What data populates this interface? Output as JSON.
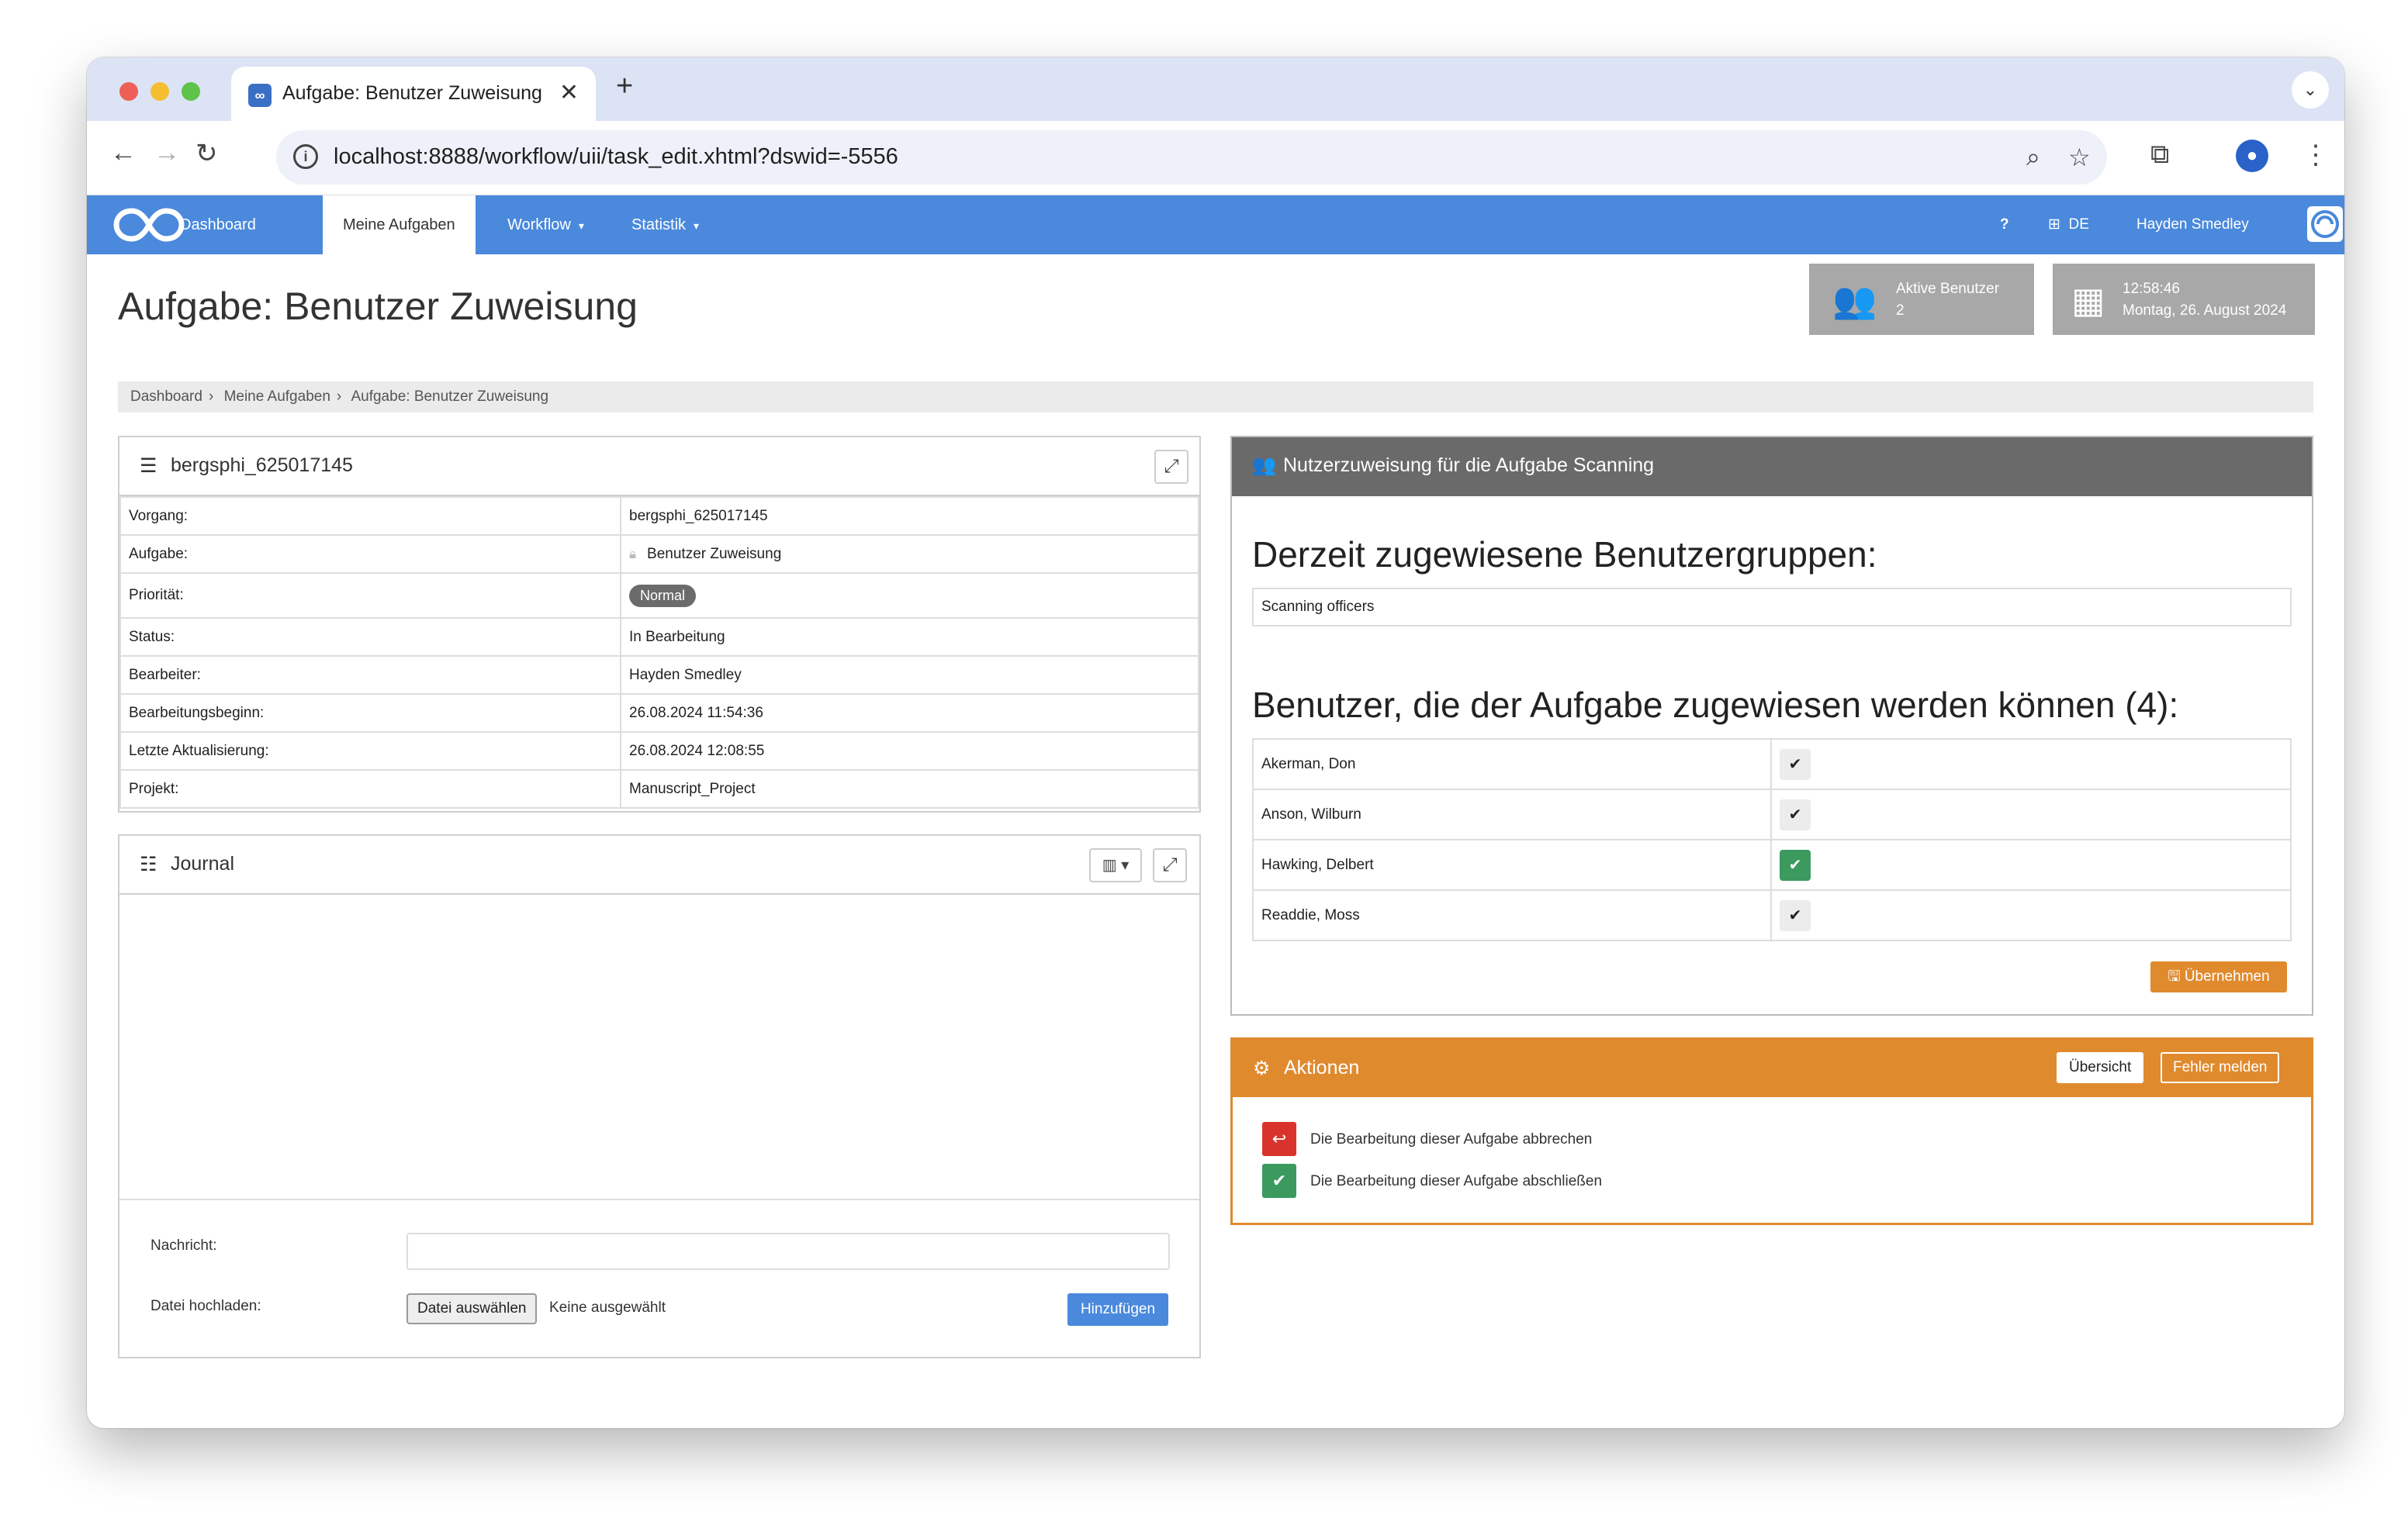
{
  "browser": {
    "tab_title": "Aufgabe: Benutzer Zuweisung",
    "url": "localhost:8888/workflow/uii/task_edit.xhtml?dswid=-5556"
  },
  "nav": {
    "items": [
      "Dashboard",
      "Meine Aufgaben",
      "Workflow",
      "Statistik"
    ],
    "help": "?",
    "language": "DE",
    "user": "Hayden Smedley"
  },
  "header": {
    "title": "Aufgabe: Benutzer Zuweisung",
    "active_users_label": "Aktive Benutzer",
    "active_users_count": "2",
    "time": "12:58:46",
    "date": "Montag, 26. August 2024"
  },
  "breadcrumb": [
    "Dashboard",
    "Meine Aufgaben",
    "Aufgabe: Benutzer Zuweisung"
  ],
  "process_panel": {
    "title": "bergsphi_625017145",
    "rows": [
      {
        "label": "Vorgang:",
        "value": "bergsphi_625017145"
      },
      {
        "label": "Aufgabe:",
        "value": "Benutzer Zuweisung"
      },
      {
        "label": "Priorität:",
        "value": "Normal"
      },
      {
        "label": "Status:",
        "value": "In Bearbeitung"
      },
      {
        "label": "Bearbeiter:",
        "value": "Hayden Smedley"
      },
      {
        "label": "Bearbeitungsbeginn:",
        "value": "26.08.2024 11:54:36"
      },
      {
        "label": "Letzte Aktualisierung:",
        "value": "26.08.2024 12:08:55"
      },
      {
        "label": "Projekt:",
        "value": "Manuscript_Project"
      }
    ]
  },
  "journal": {
    "title": "Journal",
    "message_label": "Nachricht:",
    "upload_label": "Datei hochladen:",
    "file_button": "Datei auswählen",
    "file_none": "Keine ausgewählt",
    "add_button": "Hinzufügen"
  },
  "assignment": {
    "title": "Nutzerzuweisung für die Aufgabe Scanning",
    "groups_heading": "Derzeit zugewiesene Benutzergruppen:",
    "group": "Scanning officers",
    "users_heading": "Benutzer, die der Aufgabe zugewiesen werden können (4):",
    "users": [
      {
        "name": "Akerman, Don",
        "checked": false
      },
      {
        "name": "Anson, Wilburn",
        "checked": false
      },
      {
        "name": "Hawking, Delbert",
        "checked": true
      },
      {
        "name": "Readdie, Moss",
        "checked": false
      }
    ],
    "apply_button": "Übernehmen"
  },
  "actions": {
    "title": "Aktionen",
    "overview_button": "Übersicht",
    "report_button": "Fehler melden",
    "items": [
      "Die Bearbeitung dieser Aufgabe abbrechen",
      "Die Bearbeitung dieser Aufgabe abschließen"
    ]
  },
  "colors": {
    "nav_blue": "#4a89dc",
    "orange": "#e08a2e",
    "green": "#3c9a5f",
    "red": "#d9342b",
    "panel_dark": "#6a6a6a"
  }
}
